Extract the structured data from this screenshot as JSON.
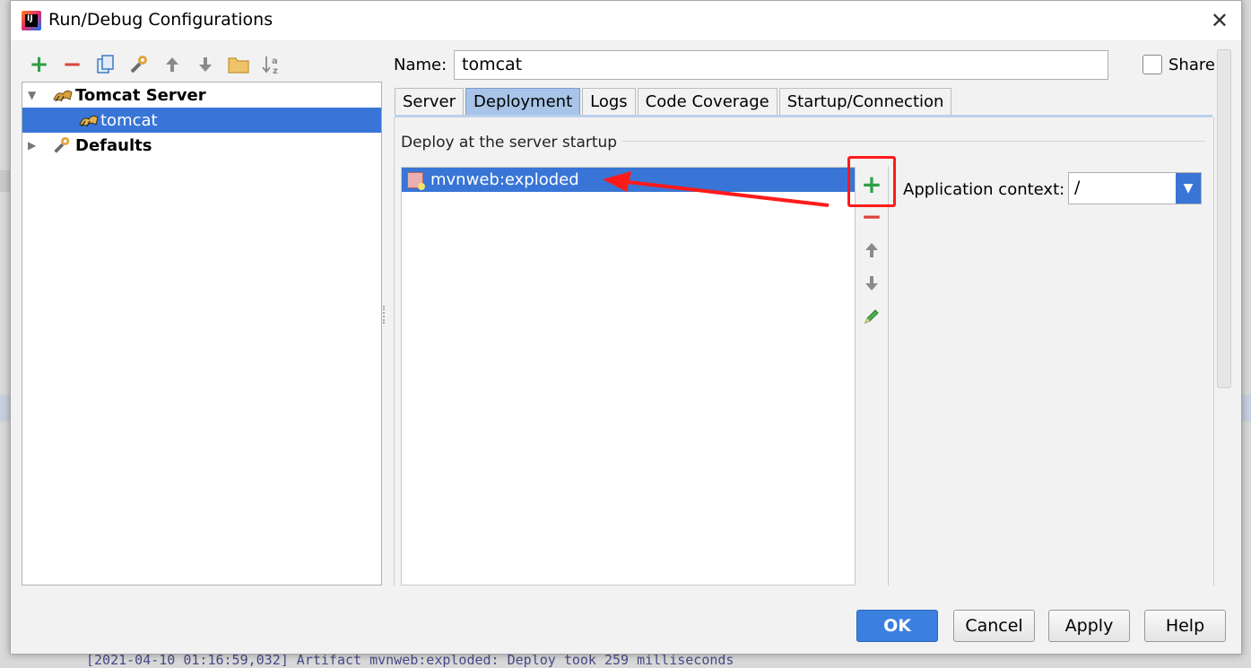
{
  "window": {
    "title": "Run/Debug Configurations",
    "close_glyph": "✕"
  },
  "toolbar": {
    "add": "+",
    "remove": "−",
    "copy": "⧉",
    "edit_defaults": "🔧",
    "move_up": "⬆",
    "move_down": "⬇",
    "folder": "📁",
    "sort": "↓a z"
  },
  "tree": {
    "items": [
      {
        "label": "Tomcat Server",
        "expanded": true
      },
      {
        "label": "tomcat",
        "selected": true
      },
      {
        "label": "Defaults",
        "expanded": false
      }
    ]
  },
  "name_field": {
    "label": "Name:",
    "value": "tomcat"
  },
  "share": {
    "label": "Share",
    "checked": false
  },
  "tabs": [
    {
      "label": "Server"
    },
    {
      "label": "Deployment",
      "active": true
    },
    {
      "label": "Logs"
    },
    {
      "label": "Code Coverage"
    },
    {
      "label": "Startup/Connection"
    }
  ],
  "deployment": {
    "section_title": "Deploy at the server startup",
    "artifacts": [
      "mvnweb:exploded"
    ],
    "side_buttons": {
      "add": "+",
      "remove": "−",
      "up": "⬆",
      "down": "⬇",
      "edit": "✎"
    },
    "app_context_label": "Application context:",
    "app_context_value": "/"
  },
  "buttons": {
    "ok": "OK",
    "cancel": "Cancel",
    "apply": "Apply",
    "help": "Help"
  },
  "background_log": "[2021-04-10 01:16:59,032] Artifact mvnweb:exploded: Deploy took 259 milliseconds",
  "colors": {
    "selection": "#3875d6",
    "add_green": "#2ea043",
    "remove_red": "#d9453c",
    "annotation_red": "#ff1a1a"
  }
}
